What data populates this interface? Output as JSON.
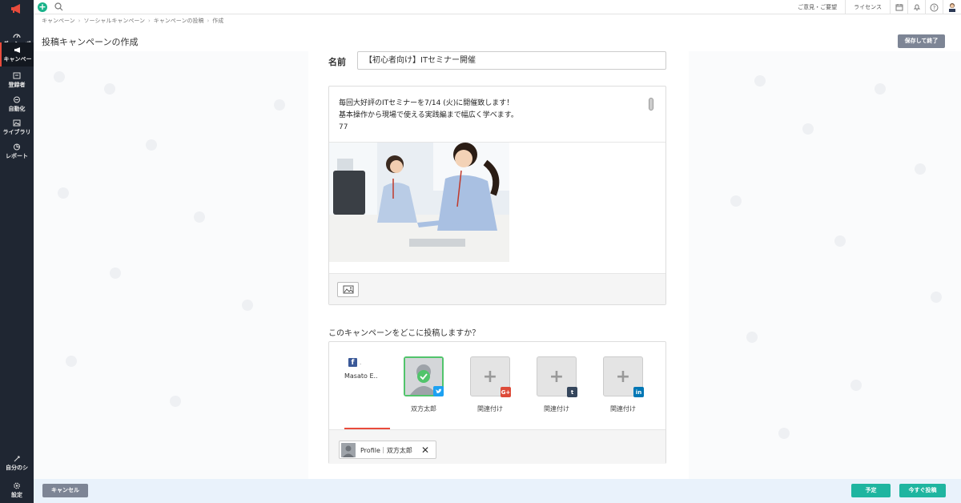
{
  "topbar": {
    "feedback": "ご意見・ご要望",
    "license": "ライセンス"
  },
  "sidebar": {
    "items": [
      {
        "label": "ダッシュボ",
        "icon": "dashboard-icon"
      },
      {
        "label": "キャンペー",
        "icon": "megaphone-icon"
      },
      {
        "label": "登録者",
        "icon": "contacts-icon"
      },
      {
        "label": "自動化",
        "icon": "automation-icon"
      },
      {
        "label": "ライブラリ",
        "icon": "library-icon"
      },
      {
        "label": "レポート",
        "icon": "report-icon"
      }
    ],
    "bottom": [
      {
        "label": "自分のシ",
        "icon": "sign-icon"
      },
      {
        "label": "設定",
        "icon": "gear-icon"
      }
    ]
  },
  "breadcrumb": {
    "items": [
      "キャンペーン",
      "ソーシャルキャンペーン",
      "キャンペーンの投稿",
      "作成"
    ]
  },
  "page": {
    "title": "投稿キャンペーンの作成",
    "save_exit": "保存して終了"
  },
  "form": {
    "name_label": "名前",
    "name_value": "【初心者向け】ITセミナー開催",
    "post_line1": "毎回大好評のITセミナーを7/14 (火)に開催致します！",
    "post_line2": "基本操作から現場で使える実践編まで幅広く学べます。",
    "char_count": "77",
    "where_question": "このキャンペーンをどこに投稿しますか？"
  },
  "accounts": {
    "facebook": {
      "dot": ".",
      "name": "Masato E.."
    },
    "twitter": {
      "label": "双方太郎",
      "badge_color": "#1da1f2"
    },
    "google": {
      "label": "関連付け",
      "badge_color": "#dd4b39",
      "badge": "G+"
    },
    "tumblr": {
      "label": "関連付け",
      "badge_color": "#35465c",
      "badge": "t"
    },
    "linkedin": {
      "label": "関連付け",
      "badge_color": "#0077b5",
      "badge": "in"
    },
    "profile_chip": "Profile｜双方太郎"
  },
  "bottom": {
    "cancel": "キャンセル",
    "schedule": "予定",
    "post_now": "今すぐ投稿"
  },
  "colors": {
    "sidebar": "#1f2632",
    "accent": "#e94b3c",
    "primary_button": "#1fb5a0",
    "secondary_button": "#7d8595"
  }
}
